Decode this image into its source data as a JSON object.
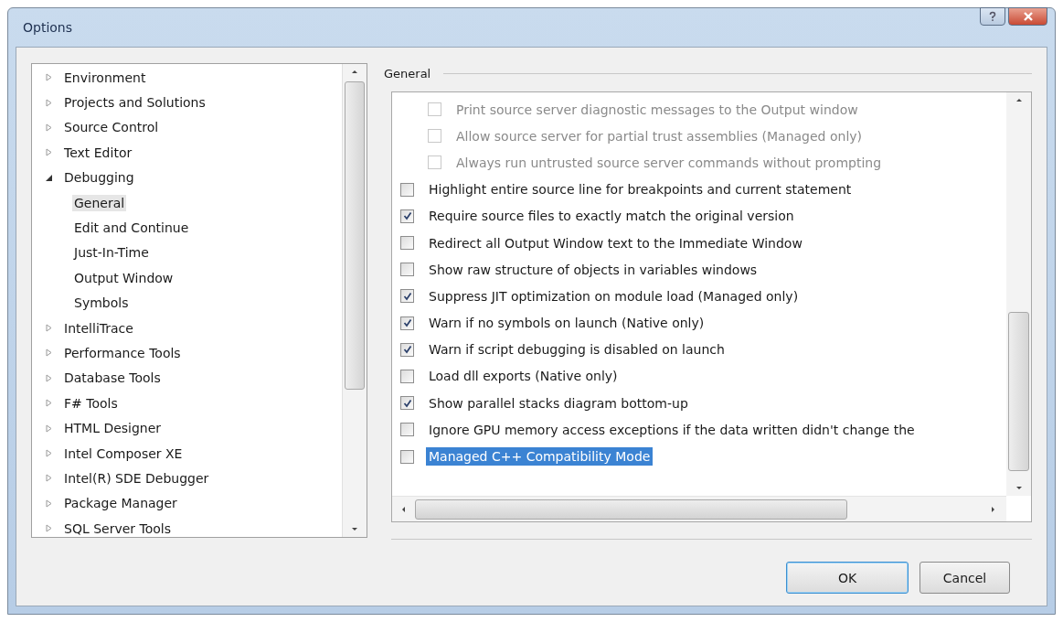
{
  "window": {
    "title": "Options"
  },
  "tree": [
    {
      "label": "Environment",
      "expanded": false,
      "selected": false
    },
    {
      "label": "Projects and Solutions",
      "expanded": false,
      "selected": false
    },
    {
      "label": "Source Control",
      "expanded": false,
      "selected": false
    },
    {
      "label": "Text Editor",
      "expanded": false,
      "selected": false
    },
    {
      "label": "Debugging",
      "expanded": true,
      "selected": false,
      "children": [
        {
          "label": "General",
          "selected": true
        },
        {
          "label": "Edit and Continue",
          "selected": false
        },
        {
          "label": "Just-In-Time",
          "selected": false
        },
        {
          "label": "Output Window",
          "selected": false
        },
        {
          "label": "Symbols",
          "selected": false
        }
      ]
    },
    {
      "label": "IntelliTrace",
      "expanded": false,
      "selected": false
    },
    {
      "label": "Performance Tools",
      "expanded": false,
      "selected": false
    },
    {
      "label": "Database Tools",
      "expanded": false,
      "selected": false
    },
    {
      "label": "F# Tools",
      "expanded": false,
      "selected": false
    },
    {
      "label": "HTML Designer",
      "expanded": false,
      "selected": false
    },
    {
      "label": "Intel Composer XE",
      "expanded": false,
      "selected": false
    },
    {
      "label": "Intel(R) SDE Debugger",
      "expanded": false,
      "selected": false
    },
    {
      "label": "Package Manager",
      "expanded": false,
      "selected": false
    },
    {
      "label": "SQL Server Tools",
      "expanded": false,
      "selected": false
    }
  ],
  "section": {
    "title": "General"
  },
  "options": [
    {
      "label": "Print source server diagnostic messages to the Output window",
      "checked": false,
      "disabled": true,
      "selected": false
    },
    {
      "label": "Allow source server for partial trust assemblies (Managed only)",
      "checked": false,
      "disabled": true,
      "selected": false
    },
    {
      "label": "Always run untrusted source server commands without prompting",
      "checked": false,
      "disabled": true,
      "selected": false
    },
    {
      "label": "Highlight entire source line for breakpoints and current statement",
      "checked": false,
      "disabled": false,
      "selected": false
    },
    {
      "label": "Require source files to exactly match the original version",
      "checked": true,
      "disabled": false,
      "selected": false
    },
    {
      "label": "Redirect all Output Window text to the Immediate Window",
      "checked": false,
      "disabled": false,
      "selected": false
    },
    {
      "label": "Show raw structure of objects in variables windows",
      "checked": false,
      "disabled": false,
      "selected": false
    },
    {
      "label": "Suppress JIT optimization on module load (Managed only)",
      "checked": true,
      "disabled": false,
      "selected": false
    },
    {
      "label": "Warn if no symbols on launch (Native only)",
      "checked": true,
      "disabled": false,
      "selected": false
    },
    {
      "label": "Warn if script debugging is disabled on launch",
      "checked": true,
      "disabled": false,
      "selected": false
    },
    {
      "label": "Load dll exports (Native only)",
      "checked": false,
      "disabled": false,
      "selected": false
    },
    {
      "label": "Show parallel stacks diagram bottom-up",
      "checked": true,
      "disabled": false,
      "selected": false
    },
    {
      "label": "Ignore GPU memory access exceptions if the data written didn't change the",
      "checked": false,
      "disabled": false,
      "selected": false
    },
    {
      "label": "Managed C++ Compatibility Mode",
      "checked": false,
      "disabled": false,
      "selected": true
    }
  ],
  "buttons": [
    "OK",
    "Cancel"
  ]
}
